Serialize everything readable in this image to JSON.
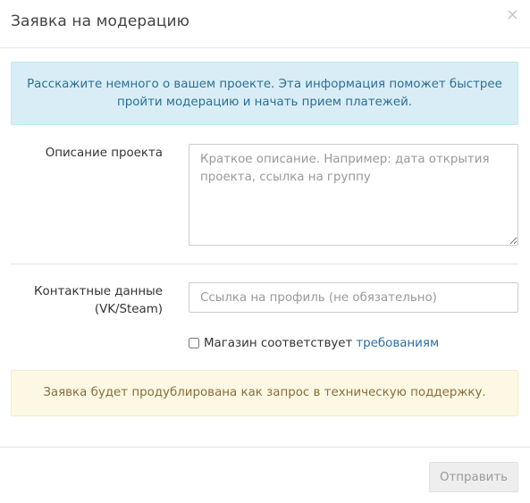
{
  "modal": {
    "title": "Заявка на модерацию",
    "close_icon": "×"
  },
  "info_alert": {
    "line1": "Расскажите немного о вашем проекте. Эта информация поможет быстрее",
    "line2": "пройти модерацию и начать прием платежей."
  },
  "form": {
    "description": {
      "label": "Описание проекта",
      "placeholder": "Краткое описание. Например: дата открытия проекта, ссылка на группу"
    },
    "contact": {
      "label_line1": "Контактные данные",
      "label_line2": "(VK/Steam)",
      "placeholder": "Ссылка на профиль (не обязательно)"
    },
    "agreement": {
      "text": "Магазин соответствует",
      "link": "требованиям",
      "checked": false
    }
  },
  "warning_alert": {
    "text": "Заявка будет продублирована как запрос в техническую поддержку."
  },
  "footer": {
    "submit_label": "Отправить"
  },
  "colors": {
    "info_bg": "#d9edf7",
    "info_text": "#2c6f92",
    "warning_bg": "#fcf8e3",
    "warning_text": "#8a6d3b",
    "link": "#2a6da3"
  }
}
